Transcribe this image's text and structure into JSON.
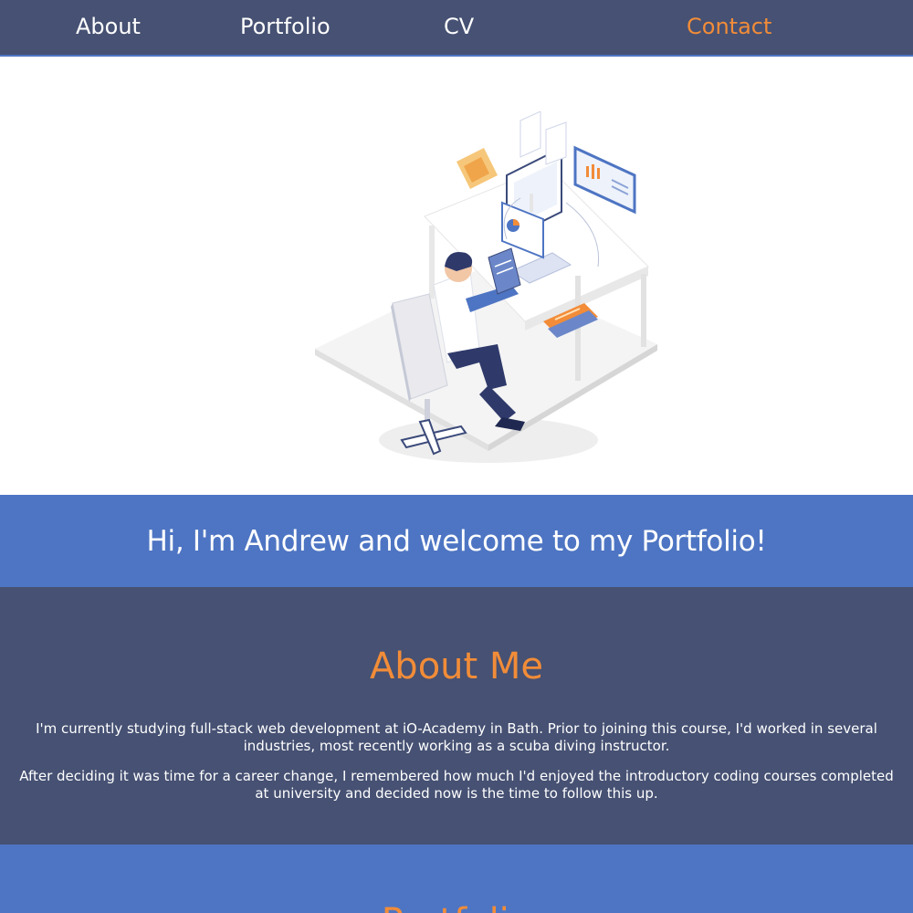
{
  "nav": {
    "links": [
      {
        "label": "About"
      },
      {
        "label": "Portfolio"
      },
      {
        "label": "CV"
      },
      {
        "label": "Contact"
      }
    ],
    "active": "Contact"
  },
  "welcome": {
    "heading": "Hi, I'm Andrew and welcome to my Portfolio!"
  },
  "about": {
    "heading": "About Me",
    "paragraph1": "I'm currently studying full-stack web development at iO-Academy in Bath. Prior to joining this course, I'd worked in several industries, most recently working as a scuba diving instructor.",
    "paragraph2": "After deciding it was time for a career change, I remembered how much I'd enjoyed the introductory coding courses completed at university and decided now is the time to follow this up."
  },
  "portfolio": {
    "heading": "Portfolio"
  },
  "colors": {
    "nav_bg": "#465173",
    "accent_blue": "#4e75c3",
    "accent_orange": "#f28c38"
  },
  "hero": {
    "illustration": "person-working-at-desk-illustration"
  }
}
